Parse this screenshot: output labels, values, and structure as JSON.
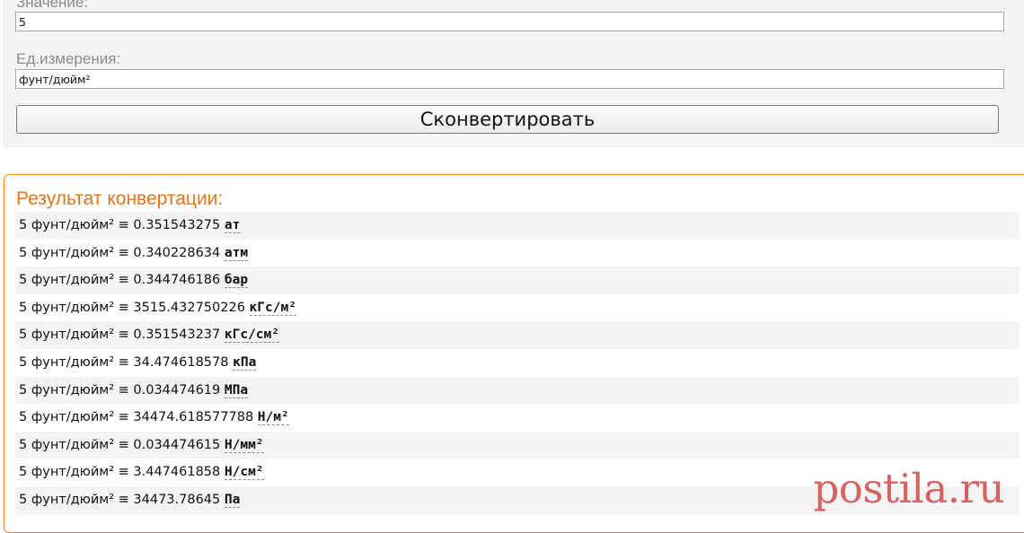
{
  "form": {
    "value_label": "Значение:",
    "value": "5",
    "unit_label": "Ед.измерения:",
    "unit": "фунт/дюйм²",
    "convert_label": "Сконвертировать"
  },
  "result": {
    "title": "Результат конвертации:",
    "rows": [
      {
        "text": "5 фунт/дюйм² ≡ 0.351543275 ",
        "unit": "ат"
      },
      {
        "text": "5 фунт/дюйм² ≡ 0.340228634 ",
        "unit": "атм"
      },
      {
        "text": "5 фунт/дюйм² ≡ 0.344746186 ",
        "unit": "бар"
      },
      {
        "text": "5 фунт/дюйм² ≡ 3515.432750226 ",
        "unit": "кГс/м²"
      },
      {
        "text": "5 фунт/дюйм² ≡ 0.351543237 ",
        "unit": "кГс/см²"
      },
      {
        "text": "5 фунт/дюйм² ≡ 34.474618578 ",
        "unit": "кПа"
      },
      {
        "text": "5 фунт/дюйм² ≡ 0.034474619 ",
        "unit": "МПа"
      },
      {
        "text": "5 фунт/дюйм² ≡ 34474.618577788 ",
        "unit": "Н/м²"
      },
      {
        "text": "5 фунт/дюйм² ≡ 0.034474615 ",
        "unit": "Н/мм²"
      },
      {
        "text": "5 фунт/дюйм² ≡ 3.447461858 ",
        "unit": "Н/см²"
      },
      {
        "text": "5 фунт/дюйм² ≡ 34473.78645 ",
        "unit": "Па"
      }
    ]
  },
  "watermark": "postila.ru",
  "colors": {
    "accent_orange": "#e8731c",
    "panel_border": "#e68a2e",
    "row_stripe": "#f4f4f4",
    "watermark": "#d24646"
  }
}
